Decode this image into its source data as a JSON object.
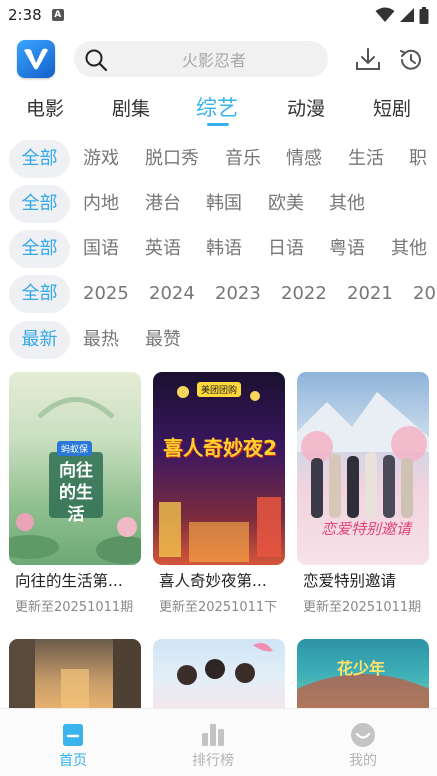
{
  "status": {
    "time": "2:38",
    "notif_letter": "A"
  },
  "search": {
    "placeholder": "火影忍者"
  },
  "categories": [
    "电影",
    "剧集",
    "综艺",
    "动漫",
    "短剧"
  ],
  "active_category_index": 2,
  "filters": [
    {
      "selected": "全部",
      "options": [
        "游戏",
        "脱口秀",
        "音乐",
        "情感",
        "生活",
        "职"
      ]
    },
    {
      "selected": "全部",
      "options": [
        "内地",
        "港台",
        "韩国",
        "欧美",
        "其他"
      ]
    },
    {
      "selected": "全部",
      "options": [
        "国语",
        "英语",
        "韩语",
        "日语",
        "粤语",
        "其他"
      ]
    },
    {
      "selected": "全部",
      "options": [
        "2025",
        "2024",
        "2023",
        "2022",
        "2021",
        "20"
      ]
    },
    {
      "selected": "最新",
      "options": [
        "最热",
        "最赞"
      ]
    }
  ],
  "items": [
    {
      "title": "向往的生活第...",
      "subtitle": "更新至20251011期",
      "poster_text": "向往的生活",
      "poster_badge": "蚂蚁保"
    },
    {
      "title": "喜人奇妙夜第...",
      "subtitle": "更新至20251011下",
      "poster_text": "喜人奇妙夜2",
      "poster_badge": "美团团购"
    },
    {
      "title": "恋爱特别邀请",
      "subtitle": "更新至20251011期",
      "poster_text": "恋爱特别邀请",
      "poster_badge": ""
    }
  ],
  "next_row_badge": "花少年",
  "nav": [
    {
      "label": "首页",
      "icon": "home-icon"
    },
    {
      "label": "排行榜",
      "icon": "chart-icon"
    },
    {
      "label": "我的",
      "icon": "smile-icon"
    }
  ],
  "colors": {
    "accent": "#35b2ee",
    "chip_bg": "#eef0f3"
  }
}
